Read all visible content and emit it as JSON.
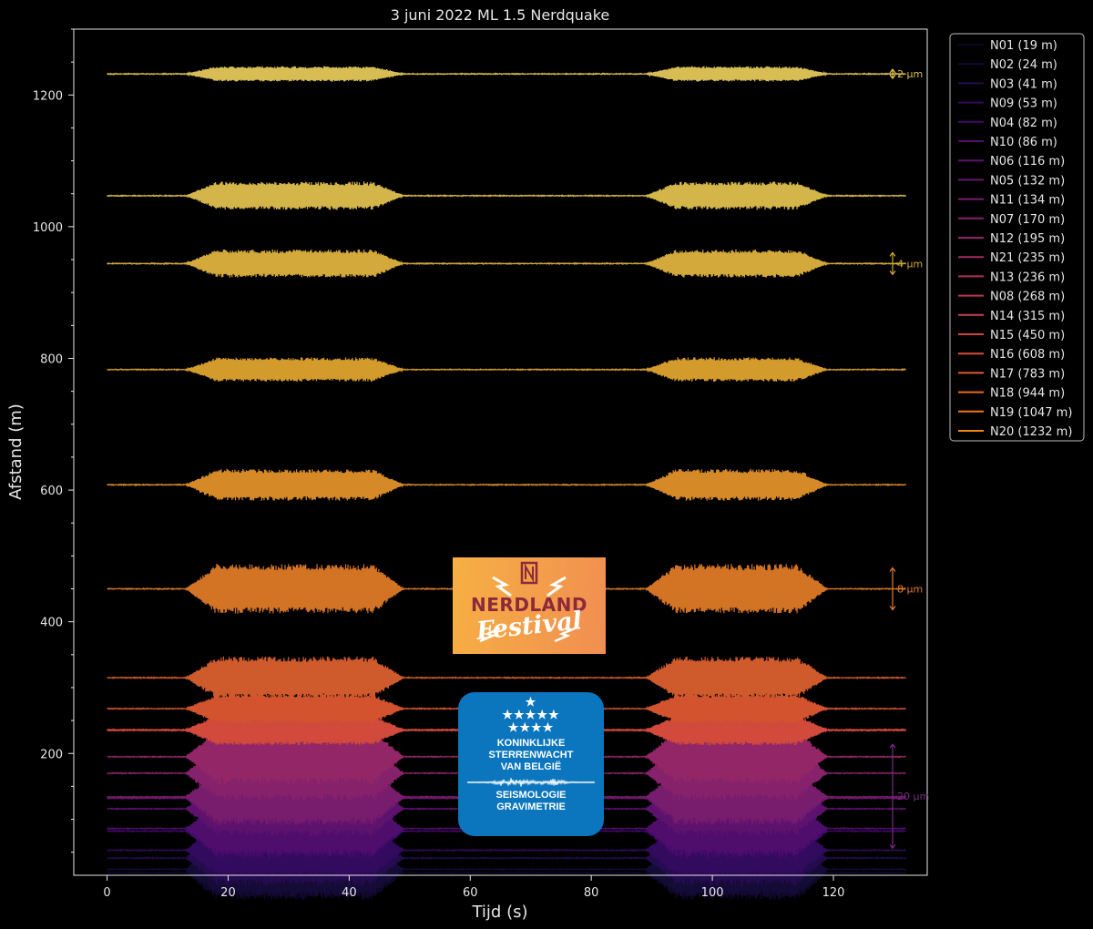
{
  "chart_data": {
    "type": "line",
    "title": "3 juni 2022 ML 1.5 Nerdquake",
    "xlabel": "Tijd (s)",
    "ylabel": "Afstand (m)",
    "xlim": [
      -5.5,
      135.5
    ],
    "ylim": [
      15,
      1300
    ],
    "xticks": [
      0,
      20,
      40,
      60,
      80,
      100,
      120
    ],
    "yticks": [
      200,
      400,
      600,
      800,
      1000,
      1200
    ],
    "grid": false,
    "legend_position": "outside-right",
    "background": "#000000",
    "signal_windows": [
      {
        "start": 13,
        "peak_start": 18,
        "peak_end": 44,
        "end": 49
      },
      {
        "start": 89,
        "peak_start": 94,
        "peak_end": 114,
        "end": 119
      }
    ],
    "series": [
      {
        "name": "N01 (19 m)",
        "distance": 19,
        "color": "#0d0829"
      },
      {
        "name": "N02 (24 m)",
        "distance": 24,
        "color": "#150b37"
      },
      {
        "name": "N03 (41 m)",
        "distance": 41,
        "color": "#240c4f"
      },
      {
        "name": "N09 (53 m)",
        "distance": 53,
        "color": "#320a5e"
      },
      {
        "name": "N04 (82 m)",
        "distance": 82,
        "color": "#420a68"
      },
      {
        "name": "N10 (86 m)",
        "distance": 86,
        "color": "#4f0d6c"
      },
      {
        "name": "N06 (116 m)",
        "distance": 116,
        "color": "#5d126e"
      },
      {
        "name": "N05 (132 m)",
        "distance": 132,
        "color": "#6a176e"
      },
      {
        "name": "N11 (134 m)",
        "distance": 134,
        "color": "#781c6d"
      },
      {
        "name": "N07 (170 m)",
        "distance": 170,
        "color": "#86216b"
      },
      {
        "name": "N12 (195 m)",
        "distance": 195,
        "color": "#932667"
      },
      {
        "name": "N21 (235 m)",
        "distance": 235,
        "color": "#a12c62"
      },
      {
        "name": "N13 (236 m)",
        "distance": 236,
        "color": "#ad305c"
      },
      {
        "name": "N08 (268 m)",
        "distance": 268,
        "color": "#ba3655"
      },
      {
        "name": "N14 (315 m)",
        "distance": 315,
        "color": "#c53f4b"
      },
      {
        "name": "N15 (450 m)",
        "distance": 450,
        "color": "#d04544"
      },
      {
        "name": "N16 (608 m)",
        "distance": 608,
        "color": "#db4d3b"
      },
      {
        "name": "N17 (783 m)",
        "distance": 783,
        "color": "#e45a31"
      },
      {
        "name": "N18 (944 m)",
        "distance": 944,
        "color": "#ed6925"
      },
      {
        "name": "N19 (1047 m)",
        "distance": 1047,
        "color": "#f1781a"
      },
      {
        "name": "N20 (1232 m)",
        "distance": 1232,
        "color": "#f4880e"
      }
    ],
    "scale_bars": [
      {
        "label": "2 µm",
        "distance": 1232,
        "color": "#e2c24e"
      },
      {
        "label": "4 µm",
        "distance": 944,
        "color": "#d6a935"
      },
      {
        "label": "8 µm",
        "distance": 450,
        "color": "#e07b2f"
      },
      {
        "label": "20 µm",
        "distance": 135,
        "color": "#7a2a86"
      }
    ]
  },
  "logos": {
    "nerdland": {
      "title": "NERDLAND",
      "subtitle": "Festival"
    },
    "ksb": {
      "name_lines": [
        "KONINKLIJKE",
        "STERRENWACHT",
        "VAN BELGIË"
      ],
      "dept_lines": [
        "SEISMOLOGIE",
        "GRAVIMETRIE"
      ],
      "stars": [
        "★",
        "★★★★★",
        "★★★★"
      ]
    }
  }
}
